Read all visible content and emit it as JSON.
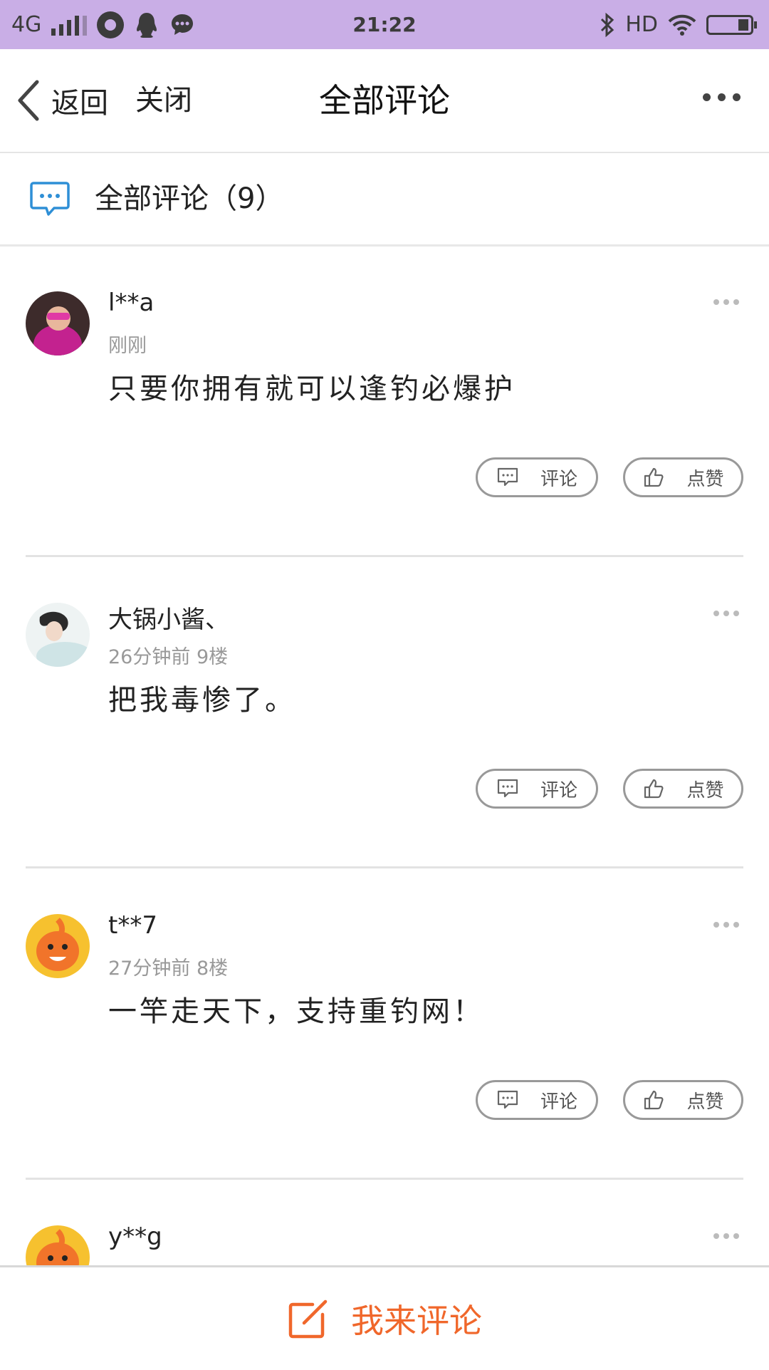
{
  "status_bar": {
    "network": "4G",
    "time": "21:22",
    "hd": "HD",
    "icons": [
      "signal-icon",
      "app-icon",
      "qq-icon",
      "message-icon",
      "bluetooth-icon",
      "wifi-icon",
      "battery-icon"
    ]
  },
  "nav": {
    "back_label": "返回",
    "close_label": "关闭",
    "title": "全部评论",
    "more_icon": "more-icon"
  },
  "section": {
    "title": "全部评论（9）",
    "icon": "comment-bubble-icon",
    "accent": "#2e8fd6"
  },
  "comments": [
    {
      "user": "l**a",
      "meta": "刚刚",
      "content": "只要你拥有就可以逢钓必爆护",
      "comment_label": "评论",
      "like_label": "点赞"
    },
    {
      "user": "大锅小酱、",
      "meta": "26分钟前  9楼",
      "content": "把我毒惨了。",
      "comment_label": "评论",
      "like_label": "点赞"
    },
    {
      "user": "t**7",
      "meta": "27分钟前  8楼",
      "content": "一竿走天下，支持重钓网！",
      "comment_label": "评论",
      "like_label": "点赞"
    },
    {
      "user": "y**g"
    }
  ],
  "bottom": {
    "label": "我来评论",
    "icon": "edit-icon",
    "color": "#f0672b"
  }
}
